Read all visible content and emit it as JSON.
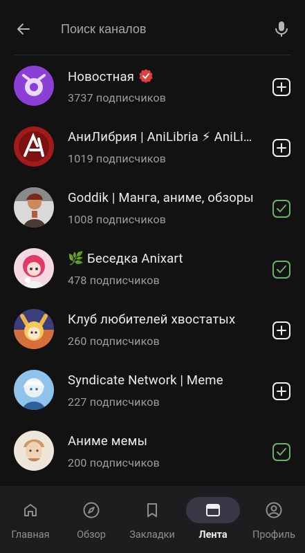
{
  "search": {
    "placeholder": "Поиск каналов"
  },
  "channels": [
    {
      "title": "Новостная",
      "subscribers": "3737 подписчиков",
      "verified": true,
      "action": "add-icon"
    },
    {
      "title": "АниЛибрия | AniLibria ⚡ AniLibria",
      "subscribers": "1019 подписчиков",
      "verified": false,
      "action": "add-icon"
    },
    {
      "title": "Goddik | Манга, аниме, обзоры",
      "subscribers": "1008 подписчиков",
      "verified": false,
      "action": "checked-icon"
    },
    {
      "title": "🌿 Беседка Anixart",
      "subscribers": "478 подписчиков",
      "verified": false,
      "action": "checked-icon"
    },
    {
      "title": "Клуб любителей хвостатых",
      "subscribers": "260 подписчиков",
      "verified": false,
      "action": "add-icon"
    },
    {
      "title": "Syndicate Network | Meme",
      "subscribers": "227 подписчиков",
      "verified": false,
      "action": "add-icon"
    },
    {
      "title": "Аниме мемы",
      "subscribers": "200 подписчиков",
      "verified": false,
      "action": "checked-icon"
    }
  ],
  "nav": {
    "items": [
      {
        "label": "Главная",
        "icon": "home-icon"
      },
      {
        "label": "Обзор",
        "icon": "compass-icon"
      },
      {
        "label": "Закладки",
        "icon": "bookmark-icon"
      },
      {
        "label": "Лента",
        "icon": "feed-icon",
        "active": true
      },
      {
        "label": "Профиль",
        "icon": "profile-icon"
      }
    ]
  },
  "colors": {
    "background": "#121212",
    "accent": "#3b3646",
    "checked": "#6bb36b",
    "verified": "#e0403d"
  }
}
